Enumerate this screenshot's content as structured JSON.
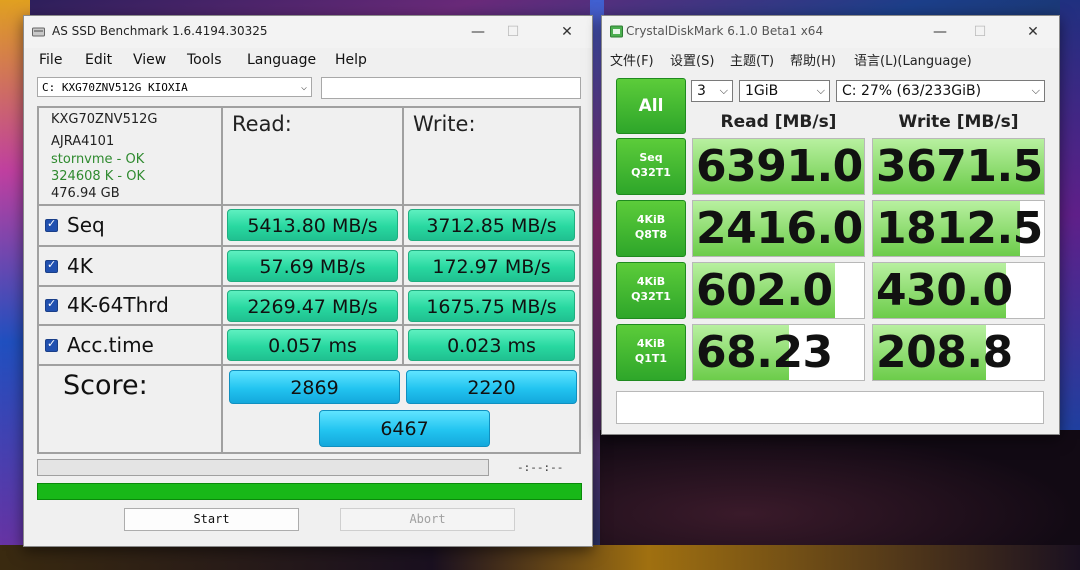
{
  "asssd": {
    "title": "AS SSD Benchmark 1.6.4194.30325",
    "controls": {
      "min": "—",
      "max": "☐",
      "close": "✕"
    },
    "menu": [
      "File",
      "Edit",
      "View",
      "Tools",
      "Language",
      "Help"
    ],
    "drive_select": "C: KXG70ZNV512G KIOXIA",
    "drive_chevron": "⌵",
    "info": {
      "model": "KXG70ZNV512G",
      "firmware": "AJRA4101",
      "driver": "stornvme - OK",
      "alignment": "324608 K - OK",
      "size": "476.94 GB"
    },
    "col_read": "Read:",
    "col_write": "Write:",
    "rows": [
      {
        "label": "Seq",
        "read": "5413.80 MB/s",
        "write": "3712.85 MB/s"
      },
      {
        "label": "4K",
        "read": "57.69 MB/s",
        "write": "172.97 MB/s"
      },
      {
        "label": "4K-64Thrd",
        "read": "2269.47 MB/s",
        "write": "1675.75 MB/s"
      },
      {
        "label": "Acc.time",
        "read": "0.057 ms",
        "write": "0.023 ms"
      }
    ],
    "score_label": "Score:",
    "score_read": "2869",
    "score_write": "2220",
    "score_total": "6467",
    "time_text": "-:--:--",
    "progress_complete": 1.0,
    "start_label": "Start",
    "abort_label": "Abort"
  },
  "cdm": {
    "title": "CrystalDiskMark 6.1.0 Beta1 x64",
    "controls": {
      "min": "—",
      "max": "☐",
      "close": "✕"
    },
    "menu": [
      "文件(F)",
      "设置(S)",
      "主题(T)",
      "帮助(H)",
      "语言(L)(Language)"
    ],
    "all_label": "All",
    "count": "3",
    "size": "1GiB",
    "drive": "C: 27% (63/233GiB)",
    "chevron": "⌵",
    "head_read": "Read [MB/s]",
    "head_write": "Write [MB/s]",
    "tests": [
      {
        "l1": "Seq",
        "l2": "Q32T1",
        "read": "6391.0",
        "write": "3671.5",
        "read_fill": 1.0,
        "write_fill": 1.0
      },
      {
        "l1": "4KiB",
        "l2": "Q8T8",
        "read": "2416.0",
        "write": "1812.5",
        "read_fill": 1.0,
        "write_fill": 0.86
      },
      {
        "l1": "4KiB",
        "l2": "Q32T1",
        "read": "602.0",
        "write": "430.0",
        "read_fill": 0.83,
        "write_fill": 0.78
      },
      {
        "l1": "4KiB",
        "l2": "Q1T1",
        "read": "68.23",
        "write": "208.8",
        "read_fill": 0.56,
        "write_fill": 0.66
      }
    ]
  }
}
